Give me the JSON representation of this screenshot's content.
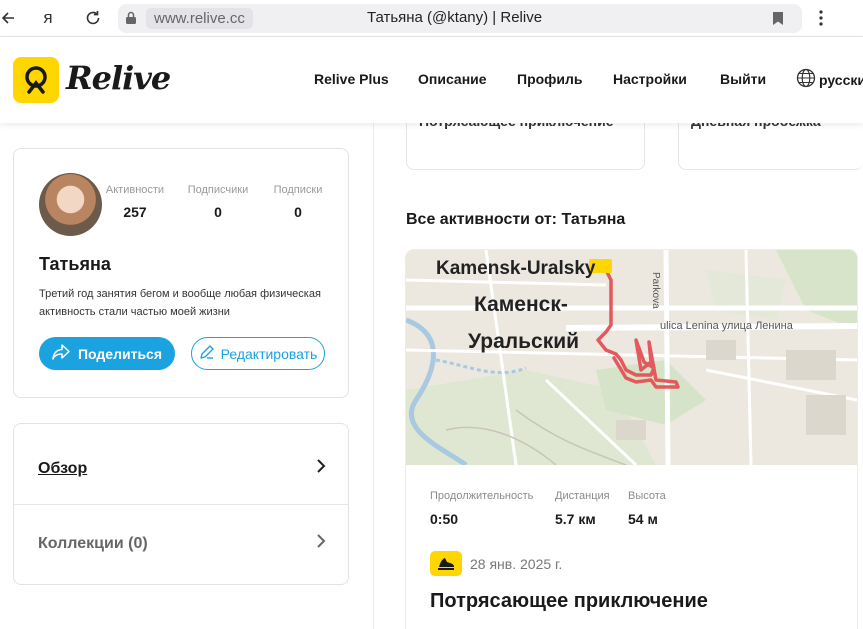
{
  "browser": {
    "url": "www.relive.cc",
    "tab_title": "Татьяна (@ktany) | Relive",
    "back_icon": "back-arrow-icon",
    "yandex_icon": "я",
    "reload_icon": "reload-icon"
  },
  "header": {
    "brand": "Relive",
    "nav": [
      "Relive Plus",
      "Описание",
      "Профиль",
      "Настройки",
      "Выйти"
    ],
    "language": "русски",
    "accent_color": "#ffd600"
  },
  "profile": {
    "stats": [
      {
        "label": "Активности",
        "value": "257"
      },
      {
        "label": "Подписчики",
        "value": "0"
      },
      {
        "label": "Подписки",
        "value": "0"
      }
    ],
    "name": "Татьяна",
    "bio": "Третий год занятия бегом и вообще любая физическая активность стали частью моей жизни",
    "share_label": "Поделиться",
    "edit_label": "Редактировать",
    "button_color": "#1ba2e0"
  },
  "menu": {
    "items": [
      {
        "label": "Обзор"
      },
      {
        "label": "Коллекции (0)"
      }
    ]
  },
  "top_cards": [
    "Потрясающее приключение",
    "Дневная пробежка"
  ],
  "activities": {
    "section_title": "Все активности от: Татьяна",
    "map_labels": {
      "city_latin": "Kamensk-Uralsky",
      "city_ru_line1": "Каменск-",
      "city_ru_line2": "Уральский",
      "street": "ulica Lenina улица Ленина",
      "road": "Parkova"
    },
    "metrics": [
      {
        "label": "Продолжительность",
        "value": "0:50"
      },
      {
        "label": "Дистанция",
        "value": "5.7 км"
      },
      {
        "label": "Высота",
        "value": "54 м"
      }
    ],
    "date": "28 янв. 2025 г.",
    "title": "Потрясающее приключение",
    "route_color": "#e4595e"
  }
}
